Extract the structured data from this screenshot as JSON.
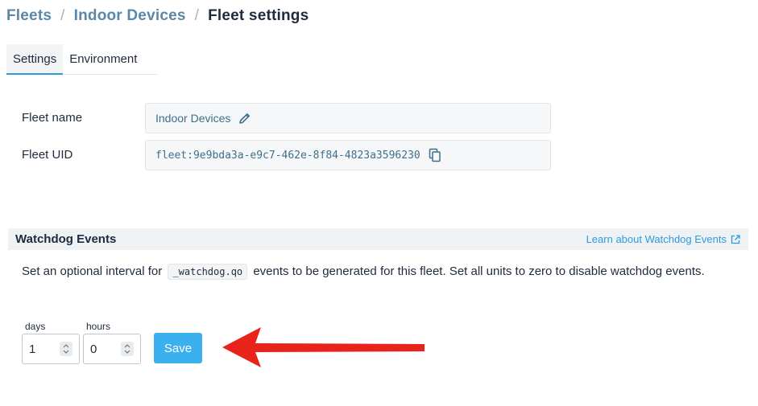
{
  "breadcrumb": {
    "items": [
      "Fleets",
      "Indoor Devices"
    ],
    "separator": "/",
    "current": "Fleet settings"
  },
  "tabs": [
    {
      "label": "Settings",
      "active": true
    },
    {
      "label": "Environment",
      "active": false
    }
  ],
  "fields": {
    "fleet_name": {
      "label": "Fleet name",
      "value": "Indoor Devices",
      "icon": "pencil-icon"
    },
    "fleet_uid": {
      "label": "Fleet UID",
      "value": "fleet:9e9bda3a-e9c7-462e-8f84-4823a3596230",
      "icon": "copy-icon"
    }
  },
  "watchdog": {
    "title": "Watchdog Events",
    "learn_link": "Learn about Watchdog Events",
    "desc_before": "Set an optional interval for",
    "code": "_watchdog.qo",
    "desc_after": "events to be generated for this fleet. Set all units to zero to disable watchdog events.",
    "days_label": "days",
    "days_value": "1",
    "hours_label": "hours",
    "hours_value": "0",
    "save_label": "Save"
  },
  "colors": {
    "accent": "#2d9cdb",
    "save_button": "#3bb0ee",
    "annotation_arrow": "#e8231b"
  }
}
